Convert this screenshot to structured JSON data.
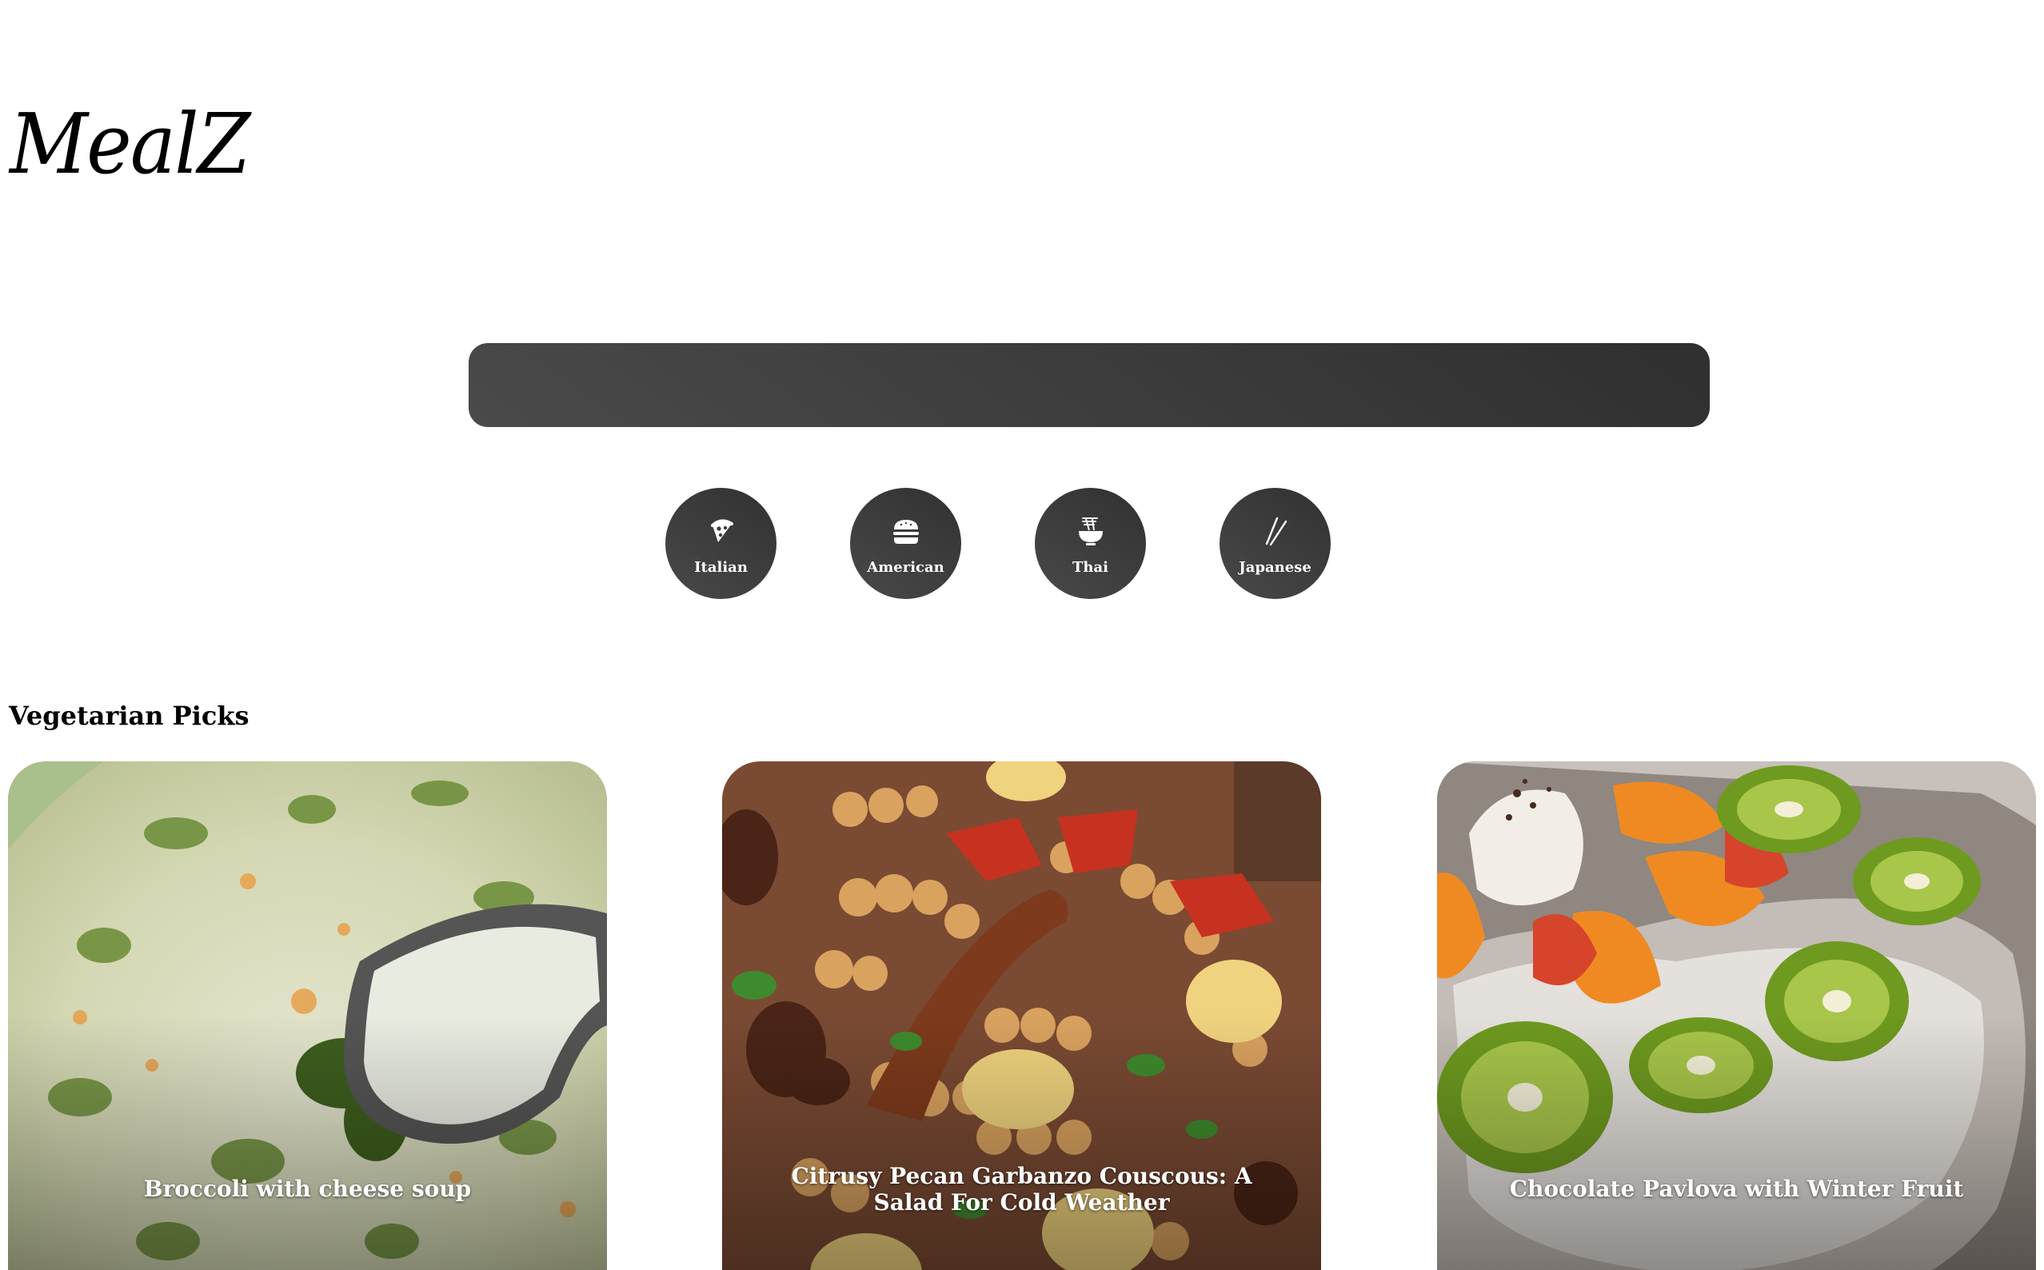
{
  "brand": {
    "logo": "MealZ"
  },
  "search": {
    "value": "",
    "placeholder": ""
  },
  "cuisines": [
    {
      "label": "Italian",
      "icon": "pizza-icon"
    },
    {
      "label": "American",
      "icon": "burger-icon"
    },
    {
      "label": "Thai",
      "icon": "noodle-bowl-icon"
    },
    {
      "label": "Japanese",
      "icon": "chopsticks-icon"
    }
  ],
  "section": {
    "title": "Vegetarian Picks"
  },
  "recipes": [
    {
      "title": "Broccoli with cheese soup",
      "image": "broccoli-cheese-soup-photo"
    },
    {
      "title": "Citrusy Pecan Garbanzo Couscous: A Salad For Cold Weather",
      "image": "pecan-couscous-salad-photo"
    },
    {
      "title": "Chocolate Pavlova with Winter Fruit",
      "image": "pavlova-winter-fruit-photo"
    }
  ],
  "colors": {
    "button_dark": "#3a3a3a",
    "text": "#000000",
    "caption": "#ffffff"
  }
}
